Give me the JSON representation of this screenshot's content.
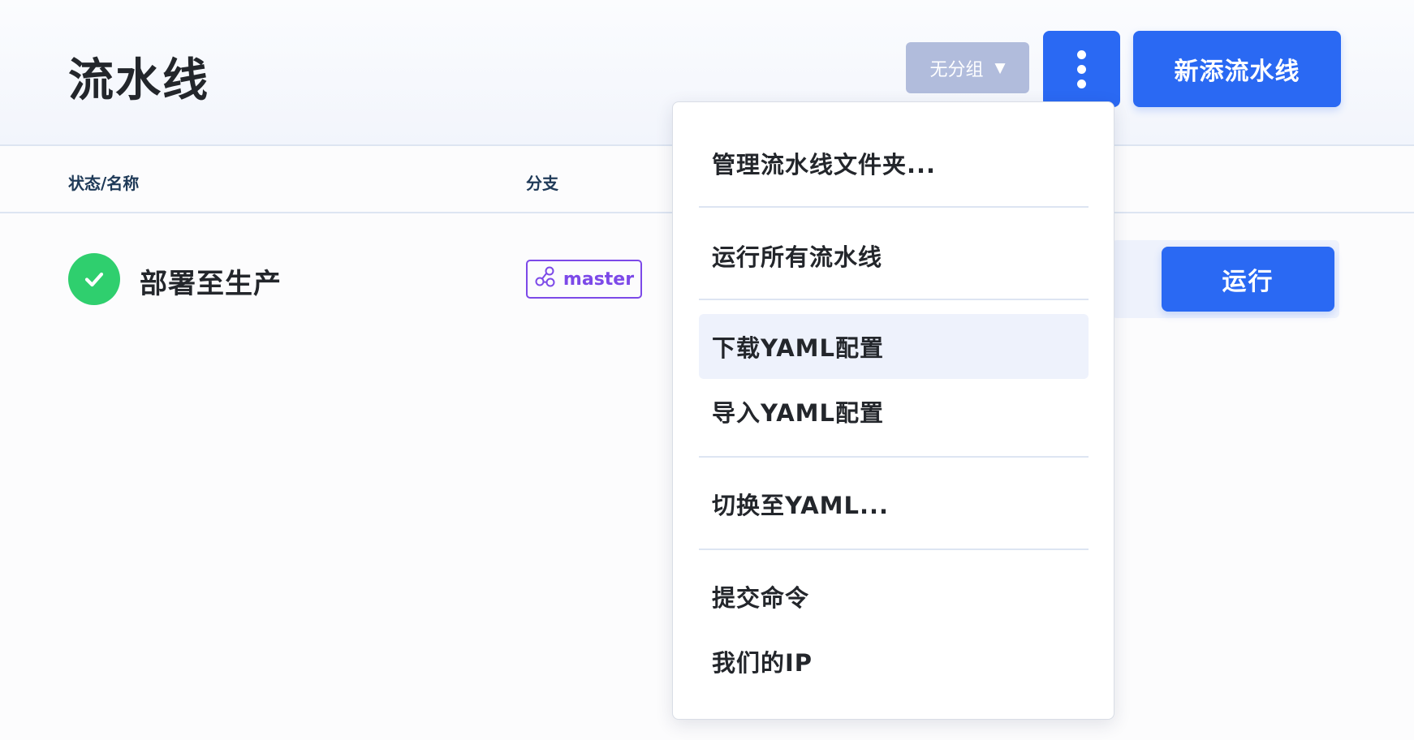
{
  "header": {
    "title": "流水线",
    "group_select": {
      "value": "无分组",
      "caret": "▼"
    },
    "new_pipeline_label": "新添流水线"
  },
  "table": {
    "columns": [
      "状态/名称",
      "分支"
    ],
    "rows": [
      {
        "status": "success",
        "name": "部署至生产",
        "branch": "master",
        "run_label": "运行"
      }
    ]
  },
  "menu": {
    "items": [
      {
        "label": "管理流水线文件夹..."
      },
      {
        "label": "运行所有流水线"
      },
      {
        "label": "下载YAML配置",
        "highlighted": true
      },
      {
        "label": "导入YAML配置"
      },
      {
        "label": "切换至YAML..."
      },
      {
        "label": "提交命令"
      },
      {
        "label": "我们的IP"
      }
    ]
  },
  "colors": {
    "primary": "#2a69f3",
    "success": "#2fcf6e",
    "branch": "#7c49e8",
    "disabled_select": "#b1bcdc"
  },
  "icons": {
    "status": "check-circle-icon",
    "branch": "git-branch-icon",
    "more": "kebab-vertical-icon",
    "caret": "caret-down-icon"
  }
}
